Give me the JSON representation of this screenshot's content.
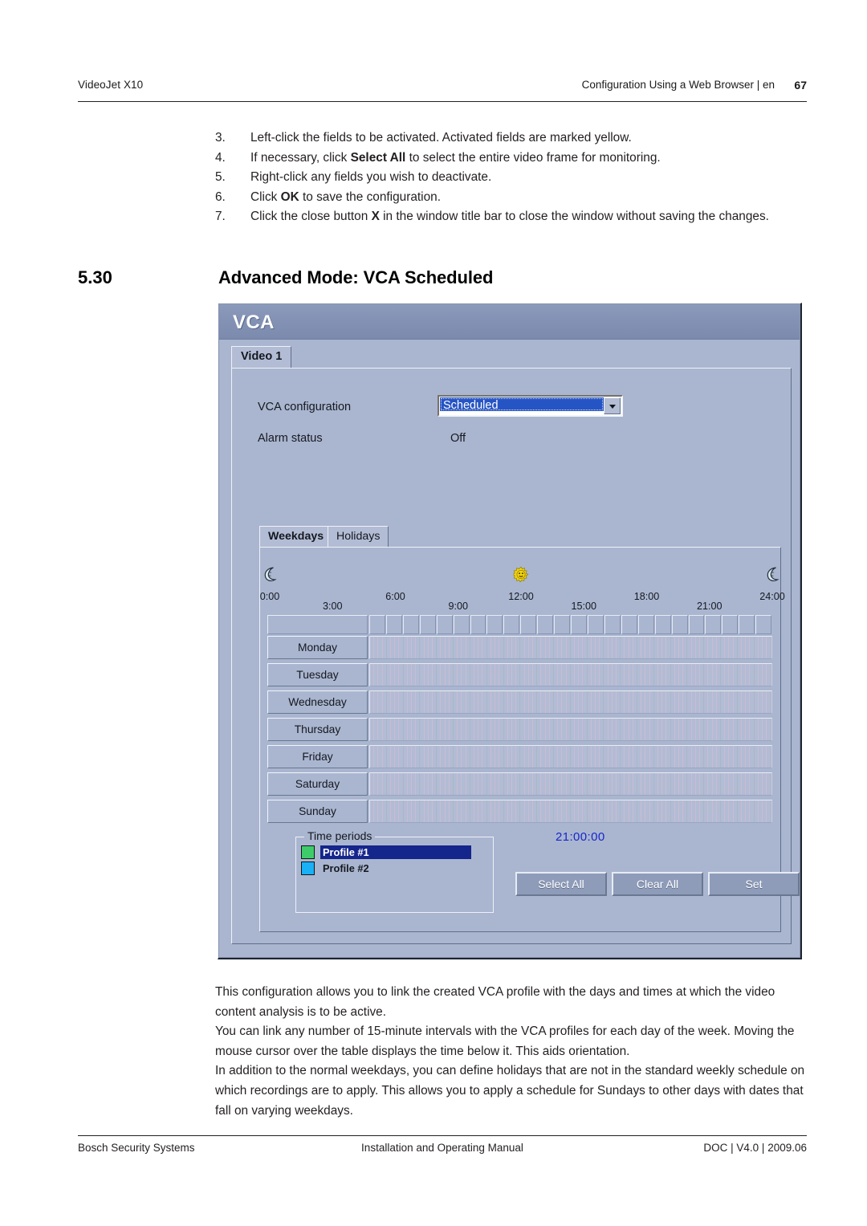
{
  "header": {
    "left": "VideoJet X10",
    "right": "Configuration Using a Web Browser | en",
    "page_number": "67"
  },
  "steps": [
    {
      "num": "3.",
      "pre": "Left-click the fields to be activated. Activated fields are marked yellow.",
      "bold": "",
      "post": ""
    },
    {
      "num": "4.",
      "pre": "If necessary, click ",
      "bold": "Select All",
      "post": " to select the entire video frame for monitoring."
    },
    {
      "num": "5.",
      "pre": "Right-click any fields you wish to deactivate.",
      "bold": "",
      "post": ""
    },
    {
      "num": "6.",
      "pre": "Click ",
      "bold": "OK",
      "post": " to save the configuration."
    },
    {
      "num": "7.",
      "pre": "Click the close button ",
      "bold": "X",
      "post": " in the window title bar to close the window without saving the changes."
    }
  ],
  "section": {
    "number": "5.30",
    "title": "Advanced Mode: VCA Scheduled"
  },
  "dialog": {
    "title": "VCA",
    "tabs": [
      "Video 1"
    ],
    "fields": {
      "vca_configuration_label": "VCA configuration",
      "vca_configuration_value": "Scheduled",
      "alarm_status_label": "Alarm status",
      "alarm_status_value": "Off"
    },
    "subtabs": [
      {
        "label": "Weekdays",
        "active": true
      },
      {
        "label": "Holidays",
        "active": false
      }
    ],
    "time_axis": {
      "ticks": [
        {
          "label": "0:00",
          "pos": 0,
          "row": "hi"
        },
        {
          "label": "3:00",
          "pos": 12.5,
          "row": "lo"
        },
        {
          "label": "6:00",
          "pos": 25,
          "row": "hi"
        },
        {
          "label": "9:00",
          "pos": 37.5,
          "row": "lo"
        },
        {
          "label": "12:00",
          "pos": 50,
          "row": "hi"
        },
        {
          "label": "15:00",
          "pos": 62.5,
          "row": "lo"
        },
        {
          "label": "18:00",
          "pos": 75,
          "row": "hi"
        },
        {
          "label": "21:00",
          "pos": 87.5,
          "row": "lo"
        },
        {
          "label": "24:00",
          "pos": 100,
          "row": "hi"
        }
      ],
      "icons": [
        {
          "name": "moon-icon",
          "pos": 0
        },
        {
          "name": "sun-icon",
          "pos": 50
        },
        {
          "name": "moon-icon",
          "pos": 100
        }
      ]
    },
    "days": [
      "Monday",
      "Tuesday",
      "Wednesday",
      "Thursday",
      "Friday",
      "Saturday",
      "Sunday"
    ],
    "hours_count": 24,
    "quarters_per_day": 96,
    "time_periods": {
      "group_title": "Time periods",
      "items": [
        {
          "label": "Profile #1",
          "color": "#3ecc6a",
          "selected": true
        },
        {
          "label": "Profile #2",
          "color": "#19b0f5",
          "selected": false
        }
      ]
    },
    "time_readout": "21:00:00",
    "buttons": [
      "Select All",
      "Clear All",
      "Set"
    ]
  },
  "body_paragraphs": [
    "This configuration allows you to link the created VCA profile with the days and times at which the video content analysis is to be active.",
    "You can link any number of 15-minute intervals with the VCA profiles for each day of the week. Moving the mouse cursor over the table displays the time below it. This aids orientation.",
    "In addition to the normal weekdays, you can define holidays that are not in the standard weekly schedule on which recordings are to apply. This allows you to apply a schedule for Sundays to other days with dates that fall on varying weekdays."
  ],
  "footer": {
    "left": "Bosch Security Systems",
    "middle": "Installation and Operating Manual",
    "right": "DOC | V4.0 | 2009.06"
  }
}
